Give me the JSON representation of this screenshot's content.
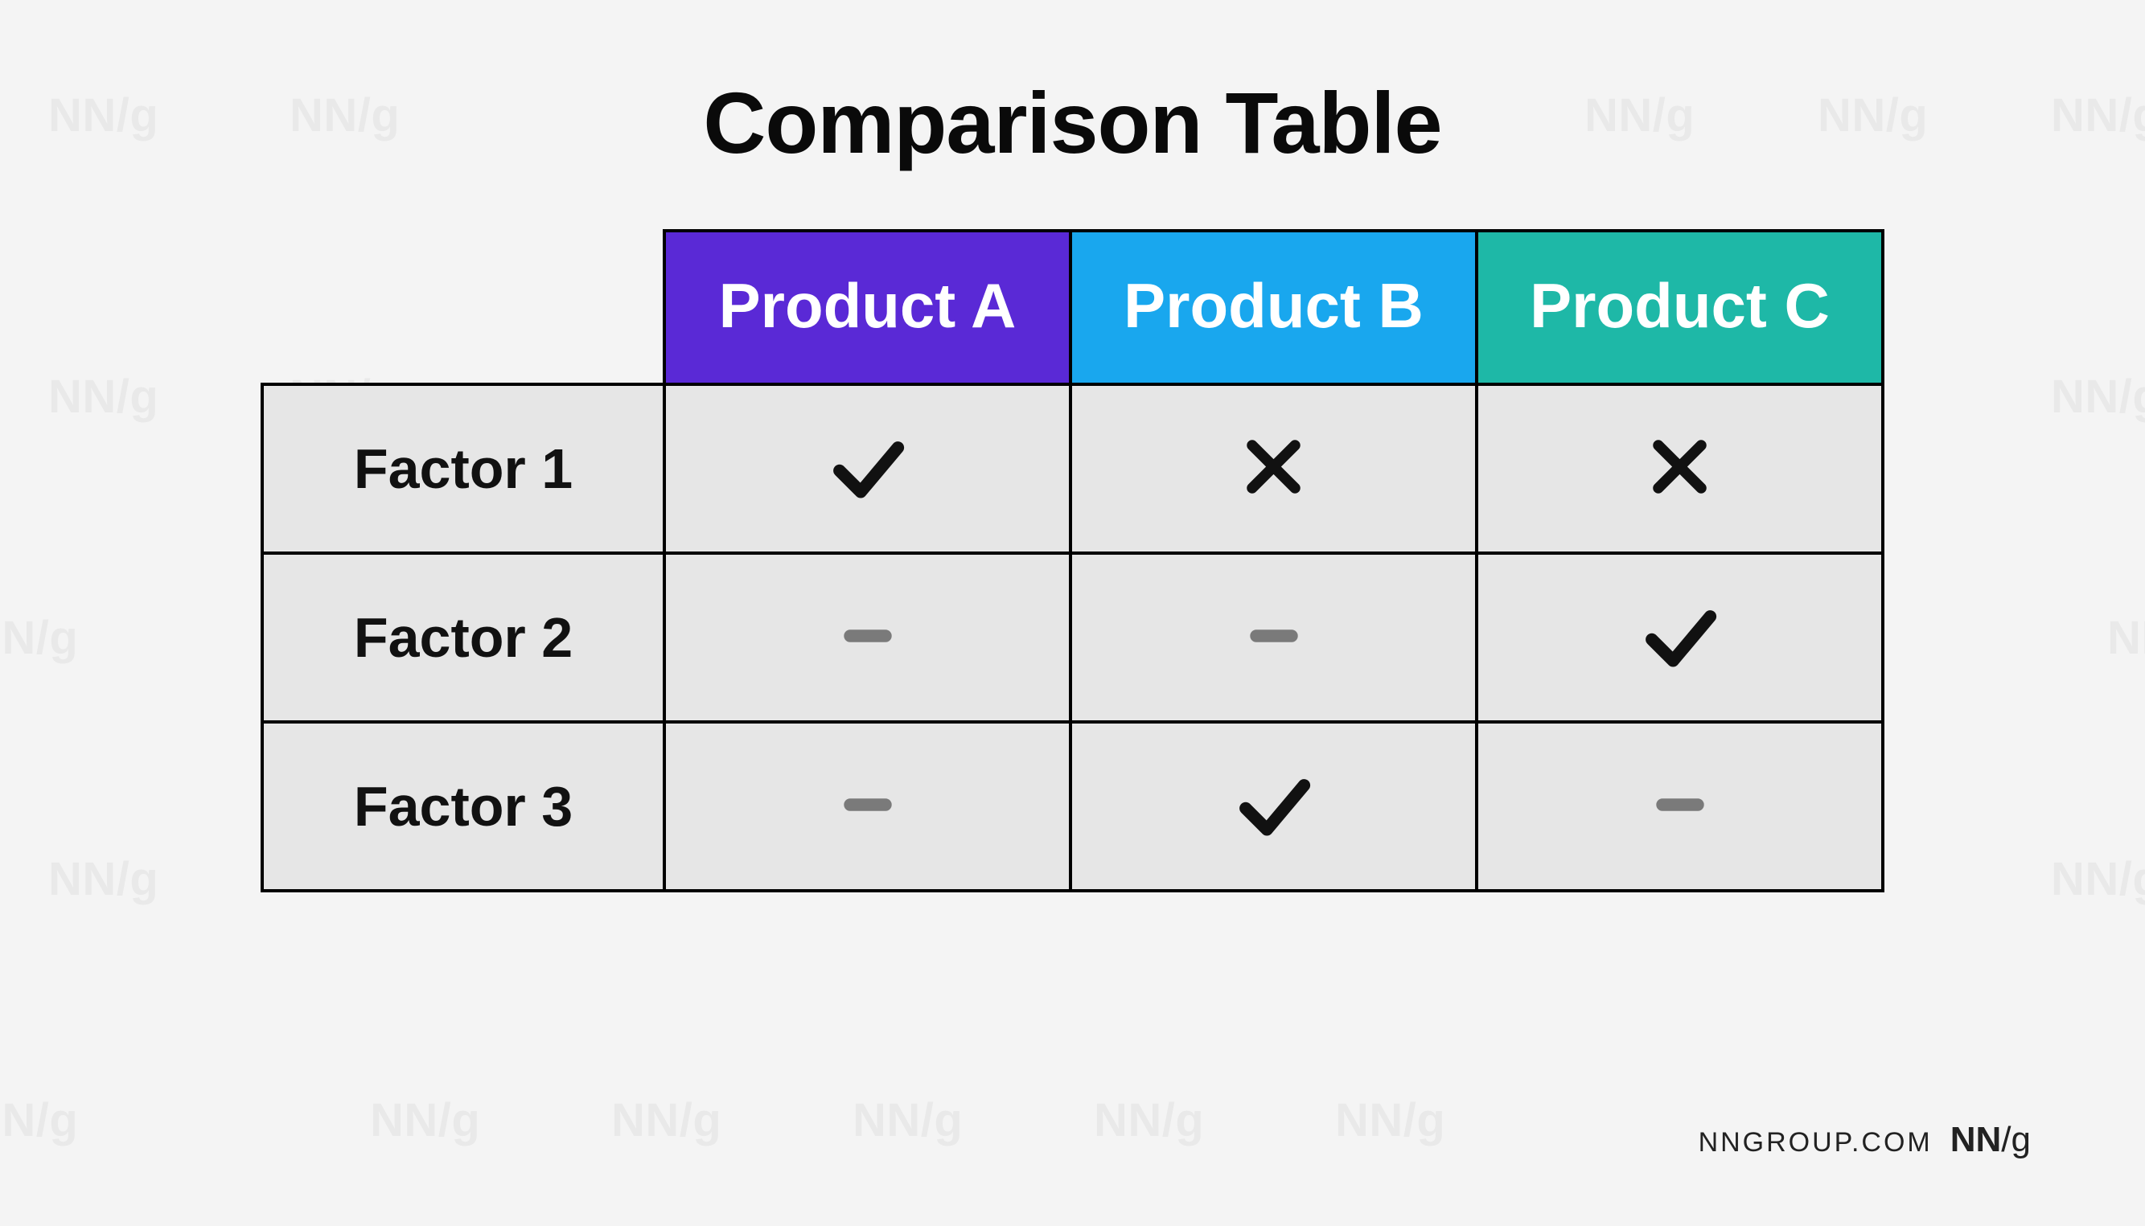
{
  "title": "Comparison Table",
  "columns": [
    {
      "label": "Product A",
      "color": "#5a29d6"
    },
    {
      "label": "Product B",
      "color": "#19a7ee"
    },
    {
      "label": "Product C",
      "color": "#1eb8a7"
    }
  ],
  "rows": [
    {
      "label": "Factor 1",
      "values": [
        "check",
        "cross",
        "cross"
      ]
    },
    {
      "label": "Factor 2",
      "values": [
        "dash",
        "dash",
        "check"
      ]
    },
    {
      "label": "Factor 3",
      "values": [
        "dash",
        "check",
        "dash"
      ]
    }
  ],
  "footer": {
    "domain": "NNGROUP.COM",
    "logo_a": "NN",
    "logo_b": "/g"
  },
  "watermark": "NN/g",
  "icons": {
    "check": {
      "aria": "yes",
      "color": "#111111"
    },
    "cross": {
      "aria": "no",
      "color": "#111111"
    },
    "dash": {
      "aria": "not-applicable",
      "color": "#7a7a7a"
    }
  }
}
